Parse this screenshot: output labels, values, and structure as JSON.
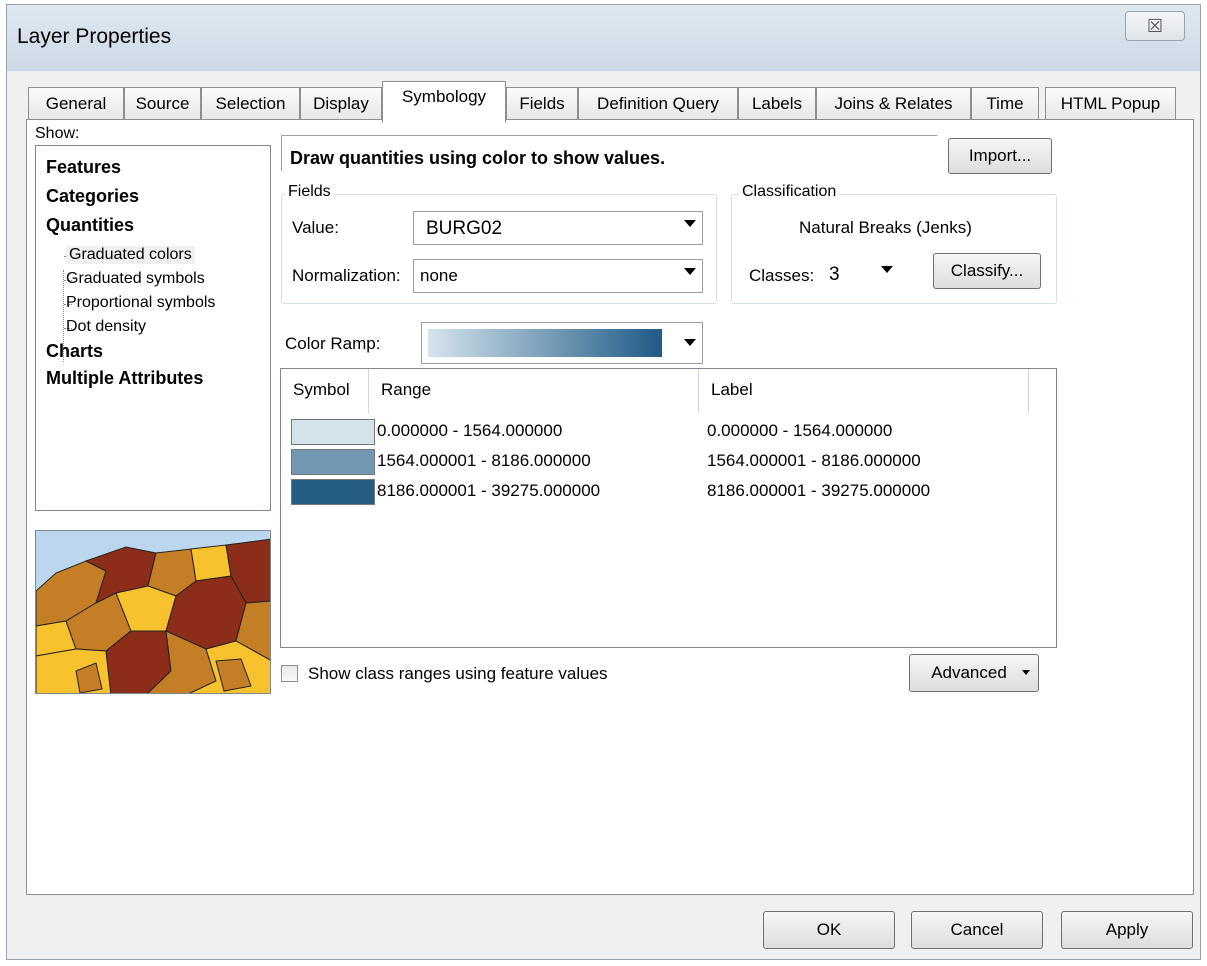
{
  "window": {
    "title": "Layer Properties",
    "close_glyph": "☒"
  },
  "tabs": [
    {
      "label": "General"
    },
    {
      "label": "Source"
    },
    {
      "label": "Selection"
    },
    {
      "label": "Display"
    },
    {
      "label": "Symbology"
    },
    {
      "label": "Fields"
    },
    {
      "label": "Definition Query"
    },
    {
      "label": "Labels"
    },
    {
      "label": "Joins & Relates"
    },
    {
      "label": "Time"
    },
    {
      "label": "HTML Popup"
    }
  ],
  "active_tab": "Symbology",
  "show": {
    "label": "Show:",
    "items": [
      {
        "label": "Features"
      },
      {
        "label": "Categories"
      },
      {
        "label": "Quantities"
      },
      {
        "label": "Graduated colors"
      },
      {
        "label": "Graduated symbols"
      },
      {
        "label": "Proportional symbols"
      },
      {
        "label": "Dot density"
      },
      {
        "label": "Charts"
      },
      {
        "label": "Multiple Attributes"
      }
    ],
    "selected": "Graduated colors"
  },
  "description": "Draw quantities using color to show values.",
  "import_label": "Import...",
  "fields": {
    "group_label": "Fields",
    "value_label": "Value:",
    "value": "BURG02",
    "normalization_label": "Normalization:",
    "normalization": "none"
  },
  "classification": {
    "group_label": "Classification",
    "method": "Natural Breaks (Jenks)",
    "classes_label": "Classes:",
    "classes": "3",
    "classify_label": "Classify..."
  },
  "color_ramp": {
    "label": "Color Ramp:",
    "start": "#d5e4ed",
    "end": "#1f5a86"
  },
  "table": {
    "headers": {
      "symbol": "Symbol",
      "range": "Range",
      "label": "Label"
    },
    "rows": [
      {
        "color": "#d3e3ea",
        "range": "0.000000 - 1564.000000",
        "label": "0.000000 - 1564.000000"
      },
      {
        "color": "#7297b2",
        "range": "1564.000001 - 8186.000000",
        "label": "1564.000001 - 8186.000000"
      },
      {
        "color": "#255d83",
        "range": "8186.000001 - 39275.000000",
        "label": "8186.000001 - 39275.000000"
      }
    ]
  },
  "show_class_ranges_label": "Show class ranges using feature values",
  "advanced_label": "Advanced",
  "buttons": {
    "ok": "OK",
    "cancel": "Cancel",
    "apply": "Apply"
  }
}
